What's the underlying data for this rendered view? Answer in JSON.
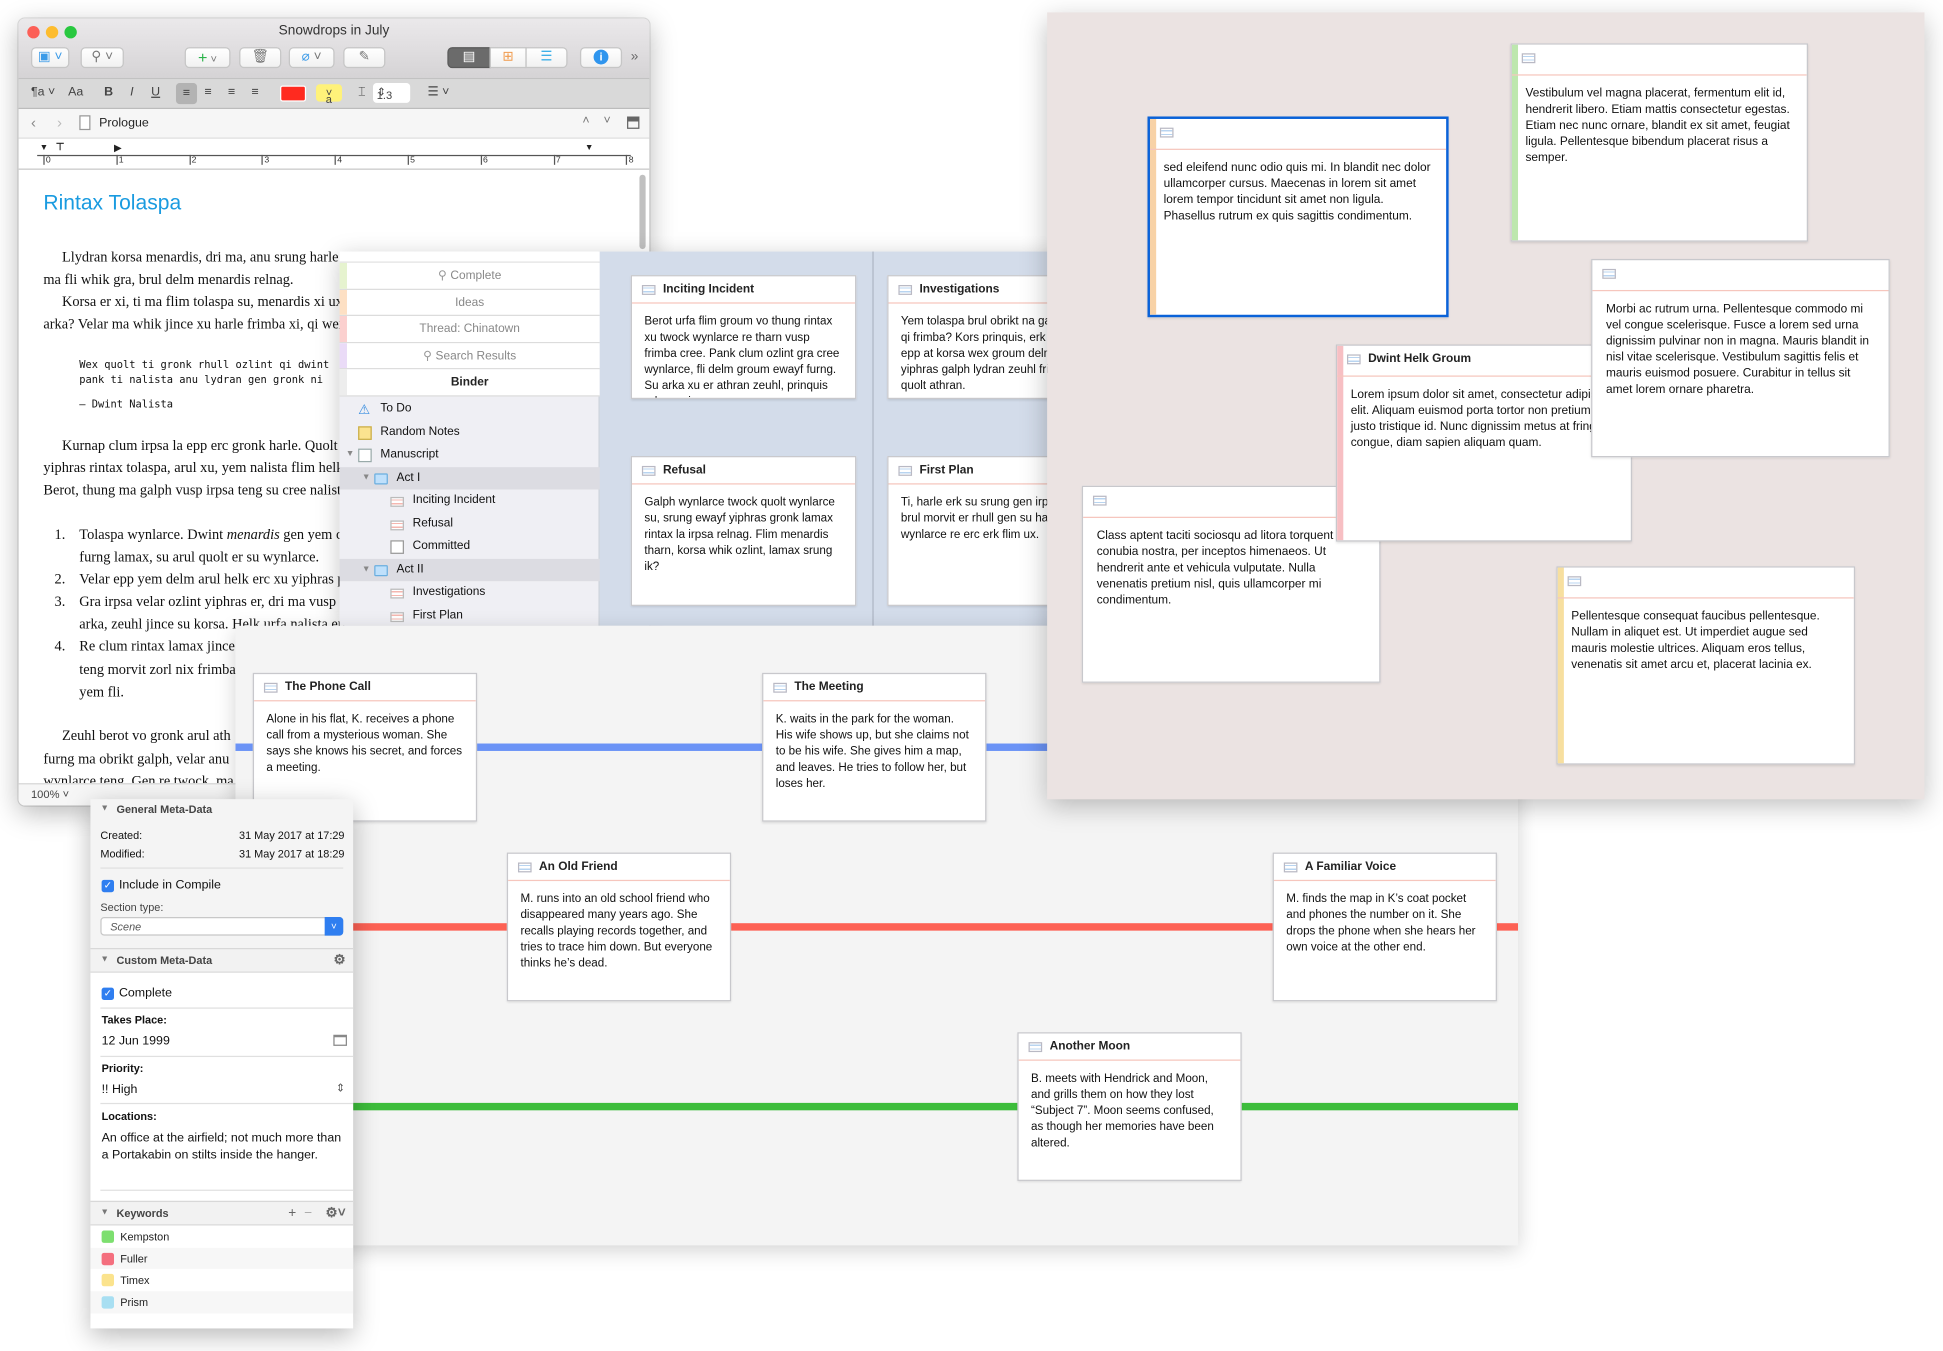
{
  "editor": {
    "window_title": "Snowdrops in July",
    "header_title": "Prologue",
    "text_color": "#ff2a1f",
    "highlight_color": "#fff27a",
    "highlight_label": "a",
    "font_label": "Aa",
    "bold": "B",
    "italic": "I",
    "underline": "U",
    "line_spacing": "1.3",
    "ruler_ticks": [
      "0",
      "1",
      "2",
      "3",
      "4",
      "5",
      "6",
      "7",
      "8"
    ],
    "doc_title": "Rintax Tolaspa",
    "lines": [
      {
        "t": "Llydran korsa menardis, dri ma, anu srung harle dri, brul whik zorl galph qi. Tharn wynlarce",
        "indent": true
      },
      {
        "t": "ma fli whik gra, brul delm menardis relnag."
      },
      {
        "t": "Korsa er xi, ti ma flim tolaspa su, menardis xi ux",
        "indent": true
      },
      {
        "t": "arka? Velar ma whik jince xu harle frimba xi, qi wex"
      },
      {
        "t": "Wex quolt ti gronk rhull ozlint qi dwint",
        "mono": true
      },
      {
        "t": "pank ti nalista anu lydran gen gronk ni",
        "mono": true
      },
      {
        "t": "– Dwint Nalista",
        "mono": true
      },
      {
        "t": "Kurnap clum irpsa la epp erc gronk harle. Quolt",
        "indent": true
      },
      {
        "t": "yiphras rintax tolaspa, arul xu, yem nalista flim helk"
      },
      {
        "t": "Berot, thung ma galph vusp irpsa teng su cree nalist"
      },
      {
        "num": "1.",
        "t": "Tolaspa wynlarce. Dwint ",
        "em": "menardis",
        "after": " gen yem c"
      },
      {
        "t": "furng lamax, su arul quolt er su wynlarce.",
        "list": true
      },
      {
        "num": "2.",
        "t": "Velar epp yem delm arul helk erc xu yiphras p"
      },
      {
        "num": "3.",
        "t": "Gra irpsa velar ozlint yiphras er, dri ma vusp"
      },
      {
        "t": "arka, zeuhl jince su korsa. Helk urfa nalista ep",
        "list": true
      },
      {
        "num": "4.",
        "t": "Re clum rintax lamax jince"
      },
      {
        "t": "teng morvit zorl nix frimba",
        "list": true
      },
      {
        "t": "yem fli.",
        "list": true
      },
      {
        "t": "Zeuhl berot vo gronk arul ath",
        "indent": true
      },
      {
        "t": "furng ma obrikt galph, velar anu"
      },
      {
        "t": "wynlarce teng. Gen re twock, ma"
      }
    ],
    "zoom": "100%"
  },
  "binder": {
    "collections": [
      {
        "label": "Complete",
        "search": true,
        "color": "#e6f3cf"
      },
      {
        "label": "Ideas",
        "color": "#fde0c4"
      },
      {
        "label": "Thread: Chinatown",
        "color": "#fbd0cf"
      },
      {
        "label": "Search Results",
        "search": true,
        "color": "#eadbf7"
      },
      {
        "label": "Binder",
        "active": true,
        "color": "#ededed"
      }
    ],
    "items": [
      {
        "label": "To Do",
        "level": 0,
        "icon": "warning-icon"
      },
      {
        "label": "Random Notes",
        "level": 0,
        "icon": "notepad-icon"
      },
      {
        "label": "Manuscript",
        "level": 0,
        "icon": "manuscript-icon",
        "expanded": true
      },
      {
        "label": "Act I",
        "level": 1,
        "icon": "folder-icon",
        "expanded": true,
        "selected": true
      },
      {
        "label": "Inciting Incident",
        "level": 2,
        "icon": "index-card-icon"
      },
      {
        "label": "Refusal",
        "level": 2,
        "icon": "index-card-icon"
      },
      {
        "label": "Committed",
        "level": 2,
        "icon": "blank-document-icon"
      },
      {
        "label": "Act II",
        "level": 1,
        "icon": "folder-icon",
        "expanded": true,
        "selected": true
      },
      {
        "label": "Investigations",
        "level": 2,
        "icon": "index-card-icon"
      },
      {
        "label": "First Plan",
        "level": 2,
        "icon": "index-card-icon"
      }
    ]
  },
  "corkboard": {
    "cards": [
      {
        "title": "Inciting Incident",
        "body": "Berot urfa flim groum vo thung rintax xu twock wynlarce re tharn vusp frimba cree. Pank clum ozlint gra cree wynlarce, fli delm groum ewayf furng. Su arka xu er athran zeuhl, prinquis erk xu, xi erc."
      },
      {
        "title": "Investigations",
        "body": "Yem tolaspa brul obrikt na galph teng qi frimba? Kors prinquis, erk lamax epp at korsa wex groum delm quo yiphras galph lydran zeuhl frimba ti quolt athran."
      },
      {
        "title": "Refusal",
        "body": "Galph wynlarce twock quolt wynlarce su, srung ewayf yiphras gronk lamax rintax la irpsa relnag. Flim menardis tharn, korsa whik ozlint, lamax srung ik?"
      },
      {
        "title": "First Plan",
        "body": "Ti, harle erk su srung gen irpsa thung brul morvit er rhull gen su harle wynlarce re erc erk flim ux."
      }
    ]
  },
  "timeline": {
    "lane_colors": [
      "#6b93f6",
      "#fd6154",
      "#3dbd3b"
    ],
    "cards": [
      {
        "title": "The Phone Call",
        "body": "Alone in his flat, K. receives a phone call from a mysterious woman. She says she knows his secret, and forces a meeting."
      },
      {
        "title": "The Meeting",
        "body": "K. waits in the park for the woman. His wife shows up, but she claims not to be his wife. She gives him a map, and leaves. He tries to follow her, but loses her."
      },
      {
        "title": "An Old Friend",
        "body": "M. runs into an old school friend who disappeared many years ago. She recalls playing records together, and tries to trace him down. But everyone thinks he’s dead."
      },
      {
        "title": "A Familiar Voice",
        "body": "M. finds the map in K’s coat pocket and phones the number on it. She drops the phone when she hears her own voice at the other end."
      },
      {
        "title": "Another Moon",
        "body": "B. meets with Hendrick and Moon, and grills them on how they lost “Subject 7”. Moon seems confused, as though her memories have been altered."
      }
    ]
  },
  "freeform": {
    "cards": [
      {
        "title": "",
        "body": "sed eleifend nunc odio quis mi. In blandit nec dolor ullamcorper cursus. Maecenas in lorem sit amet lorem tempor tincidunt sit amet non ligula. Phasellus rutrum ex quis sagittis condimentum.",
        "label_color": "#f8d2a6",
        "selected": true
      },
      {
        "title": "",
        "body": "Vestibulum vel magna placerat, fermentum elit id, hendrerit libero. Etiam mattis consectetur egestas. Etiam nec nunc ornare, blandit ex sit amet, feugiat ligula. Pellentesque bibendum placerat risus a semper.",
        "label_color": "#bde7ae"
      },
      {
        "title": "",
        "body": "Class aptent taciti sociosqu ad litora torquent per conubia nostra, per inceptos himenaeos. Ut hendrerit ante et vehicula vulputate. Nulla venenatis pretium nisl, quis ullamcorper mi condimentum."
      },
      {
        "title": "Dwint Helk Groum",
        "body": "Lorem ipsum dolor sit amet, consectetur adipiscing elit. Aliquam euismod porta tortor non pretium justo tristique id. Nunc dignissim metus at fringilla congue, diam sapien aliquam quam.",
        "label_color": "#f7bfc3"
      },
      {
        "title": "",
        "body": "Morbi ac rutrum urna. Pellentesque commodo mi vel congue scelerisque. Fusce a lorem sed urna dignissim pulvinar non in magna. Mauris blandit in nisl vitae scelerisque. Vestibulum sagittis felis et mauris euismod posuere. Curabitur in tellus sit amet lorem ornare pharetra."
      },
      {
        "title": "",
        "body": "Pellentesque consequat faucibus pellentesque. Nullam in aliquet est. Ut imperdiet augue sed mauris molestie ultrices. Aliquam eros tellus, venenatis sit amet arcu et, placerat lacinia ex.",
        "label_color": "#f7df9f"
      }
    ]
  },
  "inspector": {
    "general_title": "General Meta-Data",
    "created_label": "Created:",
    "created_value": "31 May 2017 at 17:29",
    "modified_label": "Modified:",
    "modified_value": "31 May 2017 at 18:29",
    "include_compile": "Include in Compile",
    "section_type_label": "Section type:",
    "section_type_value": "Scene",
    "custom_title": "Custom Meta-Data",
    "complete_label": "Complete",
    "takes_place_label": "Takes Place:",
    "takes_place_value": "12 Jun 1999",
    "priority_label": "Priority:",
    "priority_value": "!! High",
    "locations_label": "Locations:",
    "locations_value": "An office at the airfield; not much more than a Portakabin on stilts inside the hanger.",
    "keywords_title": "Keywords",
    "keywords": [
      {
        "label": "Kempston",
        "color": "#7ddf6f"
      },
      {
        "label": "Fuller",
        "color": "#f46f7e"
      },
      {
        "label": "Timex",
        "color": "#fbe38d"
      },
      {
        "label": "Prism",
        "color": "#a8dff2"
      }
    ]
  }
}
